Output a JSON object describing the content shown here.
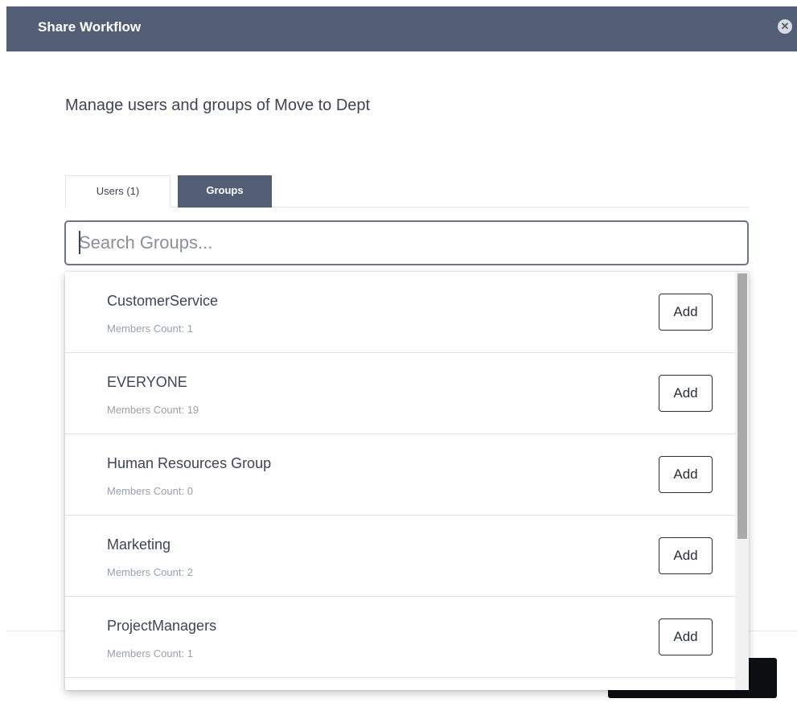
{
  "dialog": {
    "title": "Share Workflow",
    "close_icon": "close-circle-icon"
  },
  "subtitle": "Manage users and groups of Move to Dept",
  "tabs": [
    {
      "label": "Users (1)",
      "active": false
    },
    {
      "label": "Groups",
      "active": true
    }
  ],
  "search": {
    "placeholder": "Search Groups...",
    "value": ""
  },
  "groups": [
    {
      "name": "CustomerService",
      "members": "Members Count: 1",
      "action": "Add"
    },
    {
      "name": "EVERYONE",
      "members": "Members Count: 19",
      "action": "Add"
    },
    {
      "name": "Human Resources Group",
      "members": "Members Count: 0",
      "action": "Add"
    },
    {
      "name": "Marketing",
      "members": "Members Count: 2",
      "action": "Add"
    },
    {
      "name": "ProjectManagers",
      "members": "Members Count: 1",
      "action": "Add"
    }
  ],
  "colors": {
    "header": "#525d76",
    "active_tab": "#525d76",
    "primary_button": "#0d0e12"
  }
}
